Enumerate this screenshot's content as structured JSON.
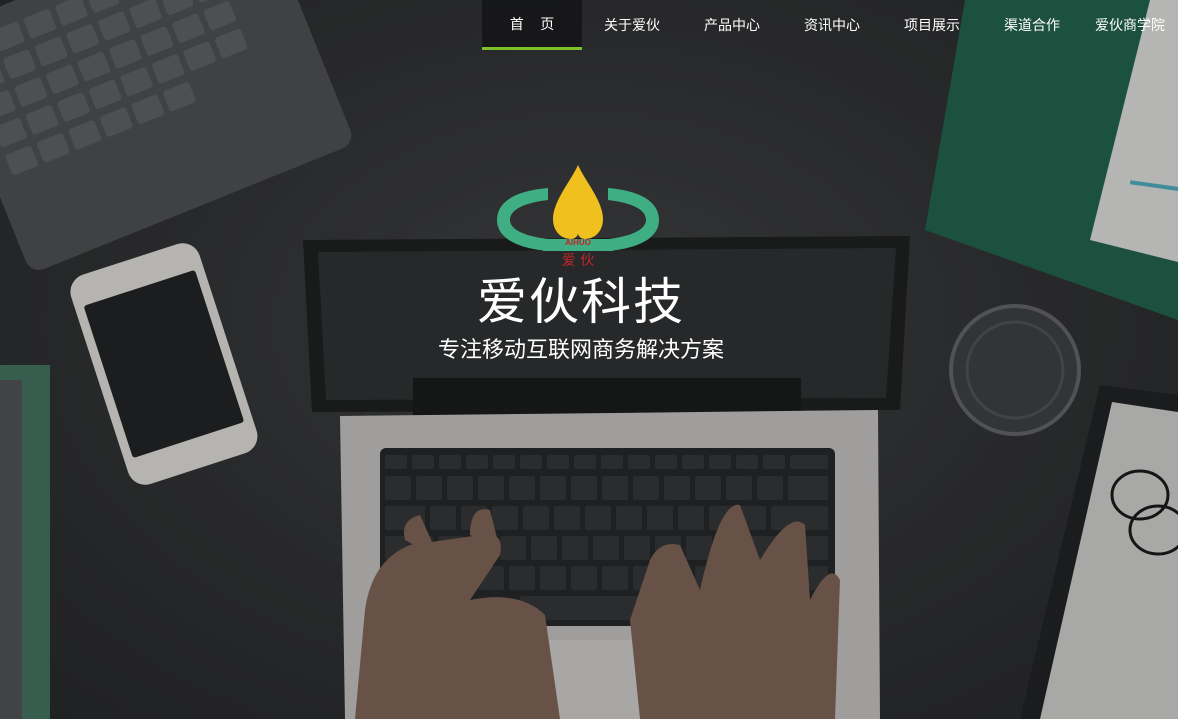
{
  "nav": {
    "items": [
      {
        "label": "首 页",
        "active": true
      },
      {
        "label": "关于爱伙"
      },
      {
        "label": "产品中心"
      },
      {
        "label": "资讯中心"
      },
      {
        "label": "项目展示"
      },
      {
        "label": "渠道合作"
      },
      {
        "label": "爱伙商学院"
      }
    ]
  },
  "hero": {
    "logo_text_latin": "AIHUO",
    "logo_text_cn": "爱 伙",
    "brand_name": "爱伙科技",
    "slogan": "专注移动互联网商务解决方案"
  },
  "colors": {
    "nav_active_underline": "#7cc128",
    "logo_ring": "#3fae83",
    "logo_drop": "#f0c11e",
    "logo_text": "#c0262b"
  }
}
